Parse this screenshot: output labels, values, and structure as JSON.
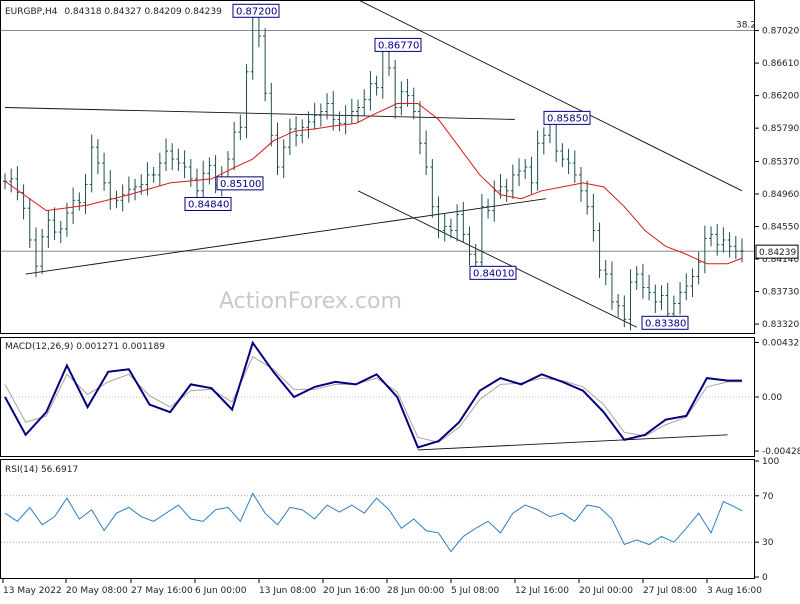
{
  "header": {
    "symbol": "EURGBP,H4",
    "ohlc": "0.84318 0.84327 0.84209 0.84239"
  },
  "watermark": "ActionForex.com",
  "colors": {
    "candles": "#1f4e4e",
    "moving_average": "#d81818",
    "macd": "#000080",
    "signal": "#b0a0a0",
    "rsi": "#2f7fc0",
    "annotation": "#000080"
  },
  "chart_data": [
    {
      "type": "line",
      "panel": "price",
      "title": "EURGBP,H4",
      "ylim": [
        0.8322,
        0.8738
      ],
      "y_ticks": [
        "0.87020",
        "0.86610",
        "0.86200",
        "0.85790",
        "0.85370",
        "0.84960",
        "0.84550",
        "0.84140",
        "0.83730",
        "0.83320"
      ],
      "x_ticks": [
        "13 May 2022",
        "20 May 08:00",
        "27 May 16:00",
        "6 Jun 00:00",
        "13 Jun 08:00",
        "20 Jun 16:00",
        "28 Jun 00:00",
        "5 Jul 08:00",
        "12 Jul 16:00",
        "20 Jul 00:00",
        "27 Jul 08:00",
        "3 Aug 16:00"
      ],
      "current_price": "0.84239",
      "fib_level": {
        "label": "38.2",
        "value": 0.8702
      },
      "annotations": [
        {
          "label": "0.87200",
          "value": 0.872,
          "date": "13 Jun 2022"
        },
        {
          "label": "0.86770",
          "value": 0.8677,
          "date": "28 Jun 2022"
        },
        {
          "label": "0.85850",
          "value": 0.8585,
          "date": "20 Jul 2022"
        },
        {
          "label": "0.85100",
          "value": 0.851,
          "date": "13 Jun 2022"
        },
        {
          "label": "0.84840",
          "value": 0.8484,
          "date": "6 Jun 2022"
        },
        {
          "label": "0.84010",
          "value": 0.8401,
          "date": "12 Jul 2022"
        },
        {
          "label": "0.83380",
          "value": 0.8338,
          "date": "27 Jul 2022"
        }
      ],
      "series": [
        {
          "role": "price",
          "x": [
            0,
            3,
            6,
            9,
            12,
            15,
            18,
            21,
            24,
            27,
            30,
            33,
            36,
            39,
            42,
            45,
            48,
            51,
            54,
            57,
            60,
            63,
            66,
            69,
            72,
            75,
            78,
            81,
            84,
            87,
            90,
            93,
            96,
            99,
            102,
            105,
            108,
            111,
            114,
            117,
            120,
            123,
            126,
            129,
            132,
            135,
            138,
            141,
            144,
            147,
            150,
            153,
            156,
            159,
            162,
            165,
            168,
            171,
            174,
            177,
            180,
            183,
            186,
            189,
            192,
            195,
            198,
            201,
            204,
            207,
            210,
            213,
            216,
            219,
            222,
            225,
            228,
            231,
            234,
            237,
            240,
            243,
            246,
            249,
            252,
            255,
            258,
            261,
            264,
            267,
            270,
            273,
            276,
            279,
            282,
            285,
            288,
            291,
            294,
            297,
            300,
            303,
            306,
            309,
            312,
            315,
            318,
            321,
            324,
            327,
            330,
            333,
            336,
            339,
            342,
            345,
            348,
            351,
            354,
            357
          ],
          "y": [
            0.8512,
            0.8515,
            0.8498,
            0.8478,
            0.8438,
            0.8405,
            0.8442,
            0.8463,
            0.8448,
            0.8452,
            0.8472,
            0.8488,
            0.8485,
            0.8508,
            0.8555,
            0.8535,
            0.851,
            0.849,
            0.8488,
            0.8495,
            0.8502,
            0.8505,
            0.8508,
            0.852,
            0.852,
            0.8535,
            0.855,
            0.854,
            0.8535,
            0.853,
            0.8515,
            0.85,
            0.8522,
            0.8532,
            0.8507,
            0.8515,
            0.854,
            0.8574,
            0.858,
            0.865,
            0.872,
            0.8695,
            0.8623,
            0.857,
            0.853,
            0.8555,
            0.8578,
            0.857,
            0.858,
            0.8587,
            0.8595,
            0.86,
            0.861,
            0.859,
            0.8585,
            0.8595,
            0.86,
            0.8605,
            0.8615,
            0.8635,
            0.863,
            0.8677,
            0.8655,
            0.8605,
            0.8625,
            0.862,
            0.86,
            0.856,
            0.853,
            0.848,
            0.845,
            0.8455,
            0.845,
            0.847,
            0.8445,
            0.842,
            0.841,
            0.848,
            0.8475,
            0.85,
            0.8505,
            0.85,
            0.852,
            0.8525,
            0.853,
            0.851,
            0.856,
            0.857,
            0.8585,
            0.855,
            0.854,
            0.8535,
            0.852,
            0.85,
            0.848,
            0.845,
            0.84,
            0.8395,
            0.836,
            0.8355,
            0.8338,
            0.8385,
            0.8395,
            0.8378,
            0.8372,
            0.836,
            0.8368,
            0.8345,
            0.8358,
            0.8372,
            0.838,
            0.8392,
            0.841,
            0.844,
            0.8445,
            0.8432,
            0.8438,
            0.843,
            0.8424,
            0.8424
          ]
        },
        {
          "role": "moving_average",
          "x": [
            0,
            20,
            40,
            60,
            80,
            100,
            110,
            120,
            130,
            140,
            150,
            160,
            170,
            180,
            190,
            200,
            210,
            220,
            230,
            240,
            250,
            260,
            270,
            280,
            290,
            300,
            310,
            320,
            330,
            340,
            350,
            357
          ],
          "y": [
            0.8512,
            0.8475,
            0.8482,
            0.8495,
            0.851,
            0.8515,
            0.8528,
            0.854,
            0.8563,
            0.8575,
            0.8578,
            0.8582,
            0.8585,
            0.8598,
            0.861,
            0.861,
            0.859,
            0.8555,
            0.852,
            0.8495,
            0.849,
            0.85,
            0.8505,
            0.851,
            0.8505,
            0.848,
            0.845,
            0.843,
            0.842,
            0.8408,
            0.8408,
            0.8415
          ]
        }
      ]
    },
    {
      "type": "line",
      "panel": "macd",
      "title": "MACD(12,26,9) 0.001271 0.001189",
      "ylim": [
        -0.0046,
        0.0046
      ],
      "y_ticks": [
        "0.004325",
        "0.00",
        "-0.004288"
      ],
      "series": [
        {
          "role": "macd",
          "x": [
            0,
            10,
            20,
            30,
            40,
            50,
            60,
            70,
            80,
            90,
            100,
            110,
            120,
            130,
            140,
            150,
            160,
            170,
            180,
            190,
            200,
            210,
            220,
            230,
            240,
            250,
            260,
            270,
            280,
            290,
            300,
            310,
            320,
            330,
            340,
            350,
            357
          ],
          "y": [
            0.0,
            -0.003,
            -0.0012,
            0.0025,
            -0.0008,
            0.002,
            0.0022,
            -0.0006,
            -0.0012,
            0.001,
            0.0007,
            -0.001,
            0.0043,
            0.002,
            0.0,
            0.0008,
            0.0012,
            0.001,
            0.0018,
            0.0,
            -0.004,
            -0.0035,
            -0.002,
            0.0005,
            0.0015,
            0.001,
            0.0018,
            0.0012,
            0.0005,
            -0.0012,
            -0.0034,
            -0.003,
            -0.0018,
            -0.0015,
            0.0015,
            0.0013,
            0.0013
          ]
        },
        {
          "role": "signal",
          "x": [
            0,
            10,
            20,
            30,
            40,
            50,
            60,
            70,
            80,
            90,
            100,
            110,
            120,
            130,
            140,
            150,
            160,
            170,
            180,
            190,
            200,
            210,
            220,
            230,
            240,
            250,
            260,
            270,
            280,
            290,
            300,
            310,
            320,
            330,
            340,
            350,
            357
          ],
          "y": [
            0.001,
            -0.002,
            -0.0015,
            0.0018,
            0.0002,
            0.0012,
            0.0018,
            0.0001,
            -0.0008,
            0.0005,
            0.0006,
            -0.0004,
            0.0032,
            0.0022,
            0.0006,
            0.0006,
            0.001,
            0.001,
            0.0015,
            0.0004,
            -0.0032,
            -0.0036,
            -0.0024,
            -0.0002,
            0.001,
            0.0011,
            0.0015,
            0.0013,
            0.0008,
            -0.0006,
            -0.0028,
            -0.0031,
            -0.0022,
            -0.0016,
            0.0008,
            0.0012,
            0.0012
          ]
        }
      ]
    },
    {
      "type": "line",
      "panel": "rsi",
      "title": "RSI(14) 56.6917",
      "ylim": [
        0,
        100
      ],
      "y_ticks": [
        "100",
        "70",
        "30",
        "0"
      ],
      "series": [
        {
          "role": "rsi",
          "x": [
            0,
            6,
            12,
            18,
            24,
            30,
            36,
            42,
            48,
            54,
            60,
            66,
            72,
            78,
            84,
            90,
            96,
            102,
            108,
            114,
            120,
            126,
            132,
            138,
            144,
            150,
            156,
            162,
            168,
            174,
            180,
            186,
            192,
            198,
            204,
            210,
            216,
            222,
            228,
            234,
            240,
            246,
            252,
            258,
            264,
            270,
            276,
            282,
            288,
            294,
            300,
            306,
            312,
            318,
            324,
            330,
            336,
            342,
            348,
            354,
            357
          ],
          "y": [
            55,
            48,
            60,
            45,
            52,
            68,
            50,
            58,
            40,
            55,
            60,
            52,
            48,
            55,
            62,
            50,
            48,
            58,
            60,
            48,
            72,
            55,
            45,
            60,
            58,
            50,
            62,
            56,
            62,
            55,
            68,
            58,
            42,
            50,
            40,
            38,
            22,
            35,
            42,
            48,
            38,
            55,
            62,
            58,
            52,
            55,
            48,
            62,
            60,
            50,
            28,
            32,
            28,
            35,
            30,
            42,
            55,
            38,
            65,
            60,
            57
          ]
        }
      ]
    }
  ]
}
